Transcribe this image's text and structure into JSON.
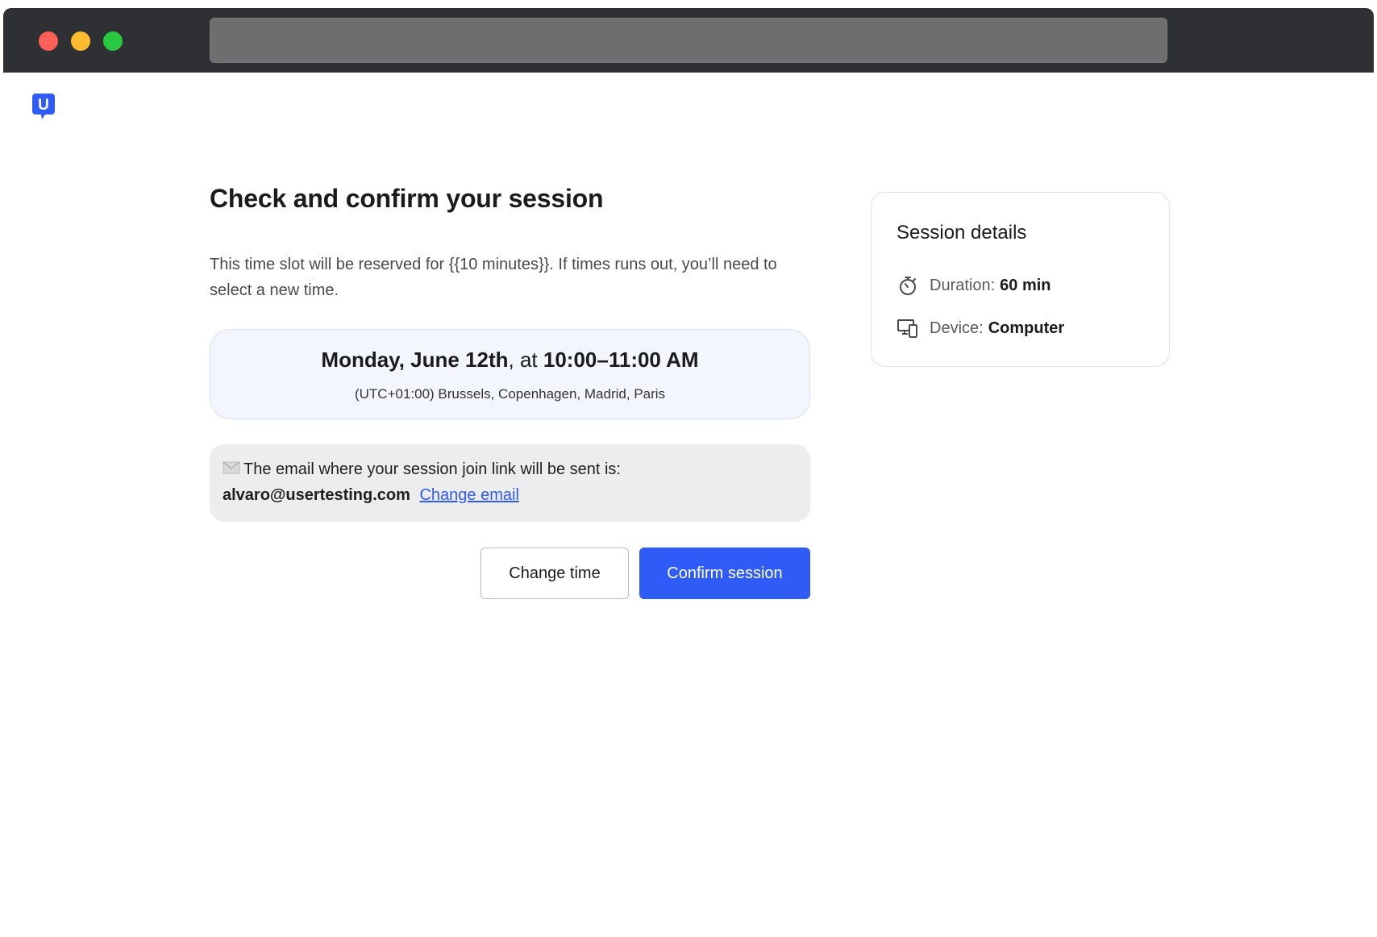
{
  "window": {
    "url": ""
  },
  "brand": {
    "logo_letter": "U",
    "logo_color": "#2f5cf7"
  },
  "main": {
    "title": "Check and confirm your session",
    "description": "This time slot will be reserved for {{10 minutes}}. If times runs out, you’ll need to select a new time.",
    "slot": {
      "date": "Monday, June 12th",
      "connector": ", at ",
      "time": "10:00–11:00 AM",
      "timezone": "(UTC+01:00) Brussels, Copenhagen, Madrid, Paris"
    },
    "email": {
      "intro": "The email where your session join link will be sent is:",
      "address": "alvaro@usertesting.com",
      "change_label": "Change email",
      "icon": "envelope-icon"
    },
    "buttons": {
      "change_time": "Change time",
      "confirm": "Confirm session"
    }
  },
  "details": {
    "title": "Session details",
    "duration_label": "Duration:",
    "duration_value": "60 min",
    "duration_icon": "stopwatch-icon",
    "device_label": "Device:",
    "device_value": "Computer",
    "device_icon": "devices-icon"
  },
  "colors": {
    "primary": "#2f5cf7",
    "slot_bg": "#f3f6fe",
    "email_bg": "#ededed",
    "titlebar": "#2f3033"
  }
}
